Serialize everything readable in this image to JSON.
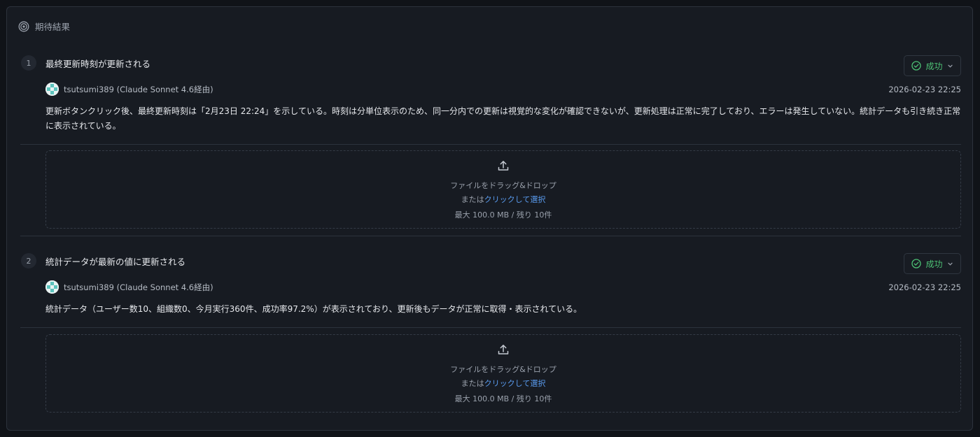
{
  "panel": {
    "title": "期待結果",
    "icon": "target-icon"
  },
  "items": [
    {
      "number": "1",
      "title": "最終更新時刻が更新される",
      "status": {
        "label": "成功",
        "color": "#4cc074"
      },
      "author": "tsutsumi389 (Claude Sonnet 4.6経由)",
      "timestamp": "2026-02-23 22:25",
      "body": "更新ボタンクリック後、最終更新時刻は「2月23日 22:24」を示している。時刻は分単位表示のため、同一分内での更新は視覚的な変化が確認できないが、更新処理は正常に完了しており、エラーは発生していない。統計データも引き続き正常に表示されている。",
      "dropzone": {
        "line1": "ファイルをドラッグ&ドロップ",
        "prefix": "または",
        "link": "クリックして選択",
        "limit": "最大 100.0 MB / 残り 10件"
      }
    },
    {
      "number": "2",
      "title": "統計データが最新の値に更新される",
      "status": {
        "label": "成功",
        "color": "#4cc074"
      },
      "author": "tsutsumi389 (Claude Sonnet 4.6経由)",
      "timestamp": "2026-02-23 22:25",
      "body": "統計データ（ユーザー数10、組織数0、今月実行360件、成功率97.2%）が表示されており、更新後もデータが正常に取得・表示されている。",
      "dropzone": {
        "line1": "ファイルをドラッグ&ドロップ",
        "prefix": "または",
        "link": "クリックして選択",
        "limit": "最大 100.0 MB / 残り 10件"
      }
    }
  ]
}
